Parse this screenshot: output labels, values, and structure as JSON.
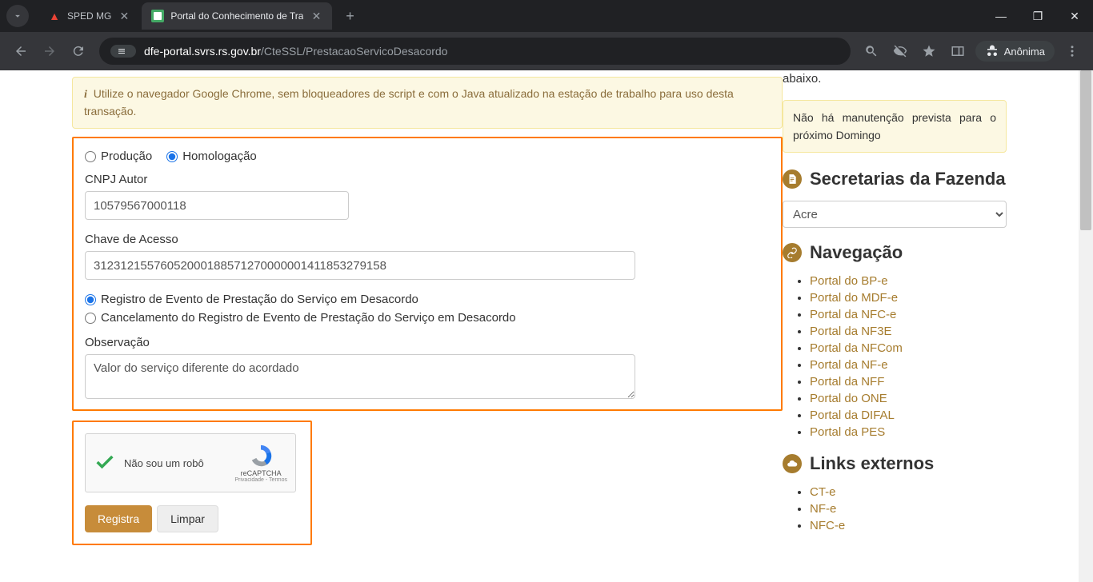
{
  "browser": {
    "tabs": [
      {
        "title": "SPED MG",
        "active": false
      },
      {
        "title": "Portal do Conhecimento de Tra",
        "active": true
      }
    ],
    "url_host": "dfe-portal.svrs.rs.gov.br",
    "url_path": "/CteSSL/PrestacaoServicoDesacordo",
    "incognito_label": "Anônima"
  },
  "alert": {
    "text": "Utilize o navegador Google Chrome, sem bloqueadores de script e com o Java atualizado na estação de trabalho para uso desta transação."
  },
  "form": {
    "env": {
      "producao": "Produção",
      "homologacao": "Homologação",
      "selected": "homologacao"
    },
    "cnpj_label": "CNPJ Autor",
    "cnpj_value": "10579567000118",
    "chave_label": "Chave de Acesso",
    "chave_value": "31231215576052000188571270000001411853279158",
    "evento": {
      "registro": "Registro de Evento de Prestação do Serviço em Desacordo",
      "cancelamento": "Cancelamento do Registro de Evento de Prestação do Serviço em Desacordo",
      "selected": "registro"
    },
    "obs_label": "Observação",
    "obs_value": "Valor do serviço diferente do acordado",
    "recaptcha_label": "Não sou um robô",
    "recaptcha_brand": "reCAPTCHA",
    "recaptcha_links": "Privacidade - Termos",
    "btn_registra": "Registra",
    "btn_limpar": "Limpar"
  },
  "sidebar": {
    "abaixo": "abaixo.",
    "maint_alert": "Não há manutenção prevista para o próximo Domingo",
    "heading_secretarias": "Secretarias da Fazenda",
    "select_value": "Acre",
    "heading_nav": "Navegação",
    "nav_links": [
      "Portal do BP-e",
      "Portal do MDF-e",
      "Portal da NFC-e",
      "Portal da NF3E",
      "Portal da NFCom",
      "Portal da NF-e",
      "Portal da NFF",
      "Portal do ONE",
      "Portal da DIFAL",
      "Portal da PES"
    ],
    "heading_links": "Links externos",
    "ext_links": [
      "CT-e",
      "NF-e",
      "NFC-e"
    ]
  }
}
